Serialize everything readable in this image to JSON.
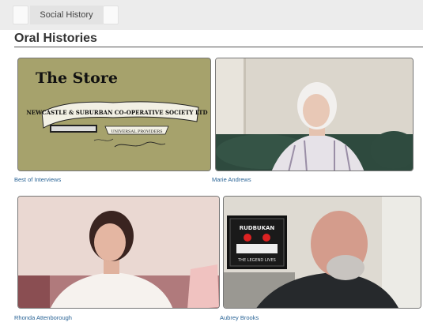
{
  "header": {
    "tab_label": "Social History"
  },
  "page": {
    "title": "Oral Histories"
  },
  "cards": [
    {
      "caption": "Best of Interviews",
      "thumb_title": "The Store",
      "thumb_banner": "NEWCASTLE & SUBURBAN CO-OPERATIVE SOCIETY LTD",
      "thumb_sub": "UNIVERSAL PROVIDERS"
    },
    {
      "caption": "Marie Andrews"
    },
    {
      "caption": "Rhonda Attenborough"
    },
    {
      "caption": "Aubrey Brooks",
      "thumb_sign_top": "RUDBUKAN",
      "thumb_sign_bottom": "THE LEGEND LIVES"
    }
  ],
  "colors": {
    "link": "#2a6496",
    "title": "#333333",
    "topbar": "#ececec"
  }
}
